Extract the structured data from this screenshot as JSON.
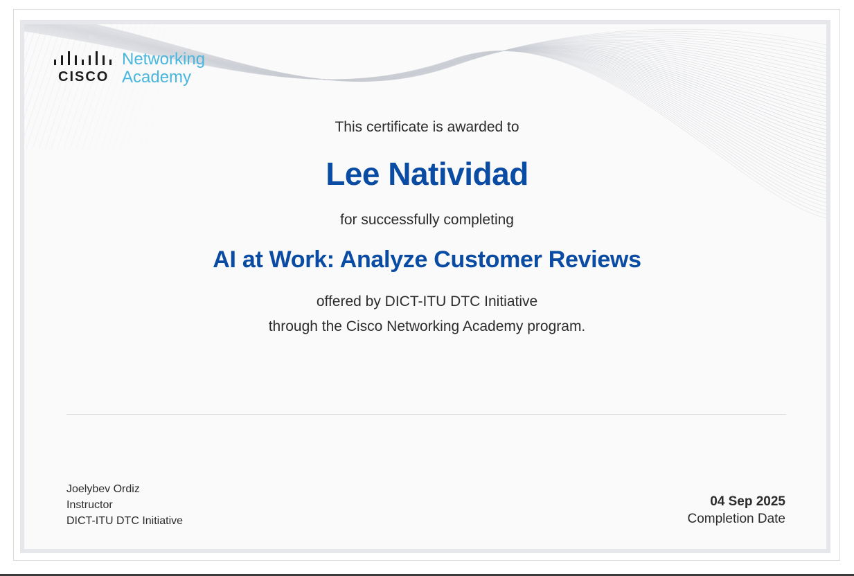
{
  "logo": {
    "wordmark": "cisco",
    "line1": "Networking",
    "line2": "Academy",
    "icon": "cisco-bridge-logo-icon",
    "accent_color": "#49b6dd"
  },
  "certificate": {
    "awarded_to_text": "This certificate is awarded to",
    "recipient_name": "Lee Natividad",
    "completing_text": "for successfully completing",
    "course_title": "AI at Work: Analyze Customer Reviews",
    "offered_by_text": "offered by DICT-ITU DTC Initiative",
    "program_text": "through the Cisco Networking Academy program.",
    "highlight_color": "#0a4ba3"
  },
  "instructor": {
    "name": "Joelybev Ordiz",
    "role": "Instructor",
    "organization": "DICT-ITU DTC Initiative"
  },
  "completion": {
    "date": "04 Sep 2025",
    "label": "Completion Date"
  }
}
